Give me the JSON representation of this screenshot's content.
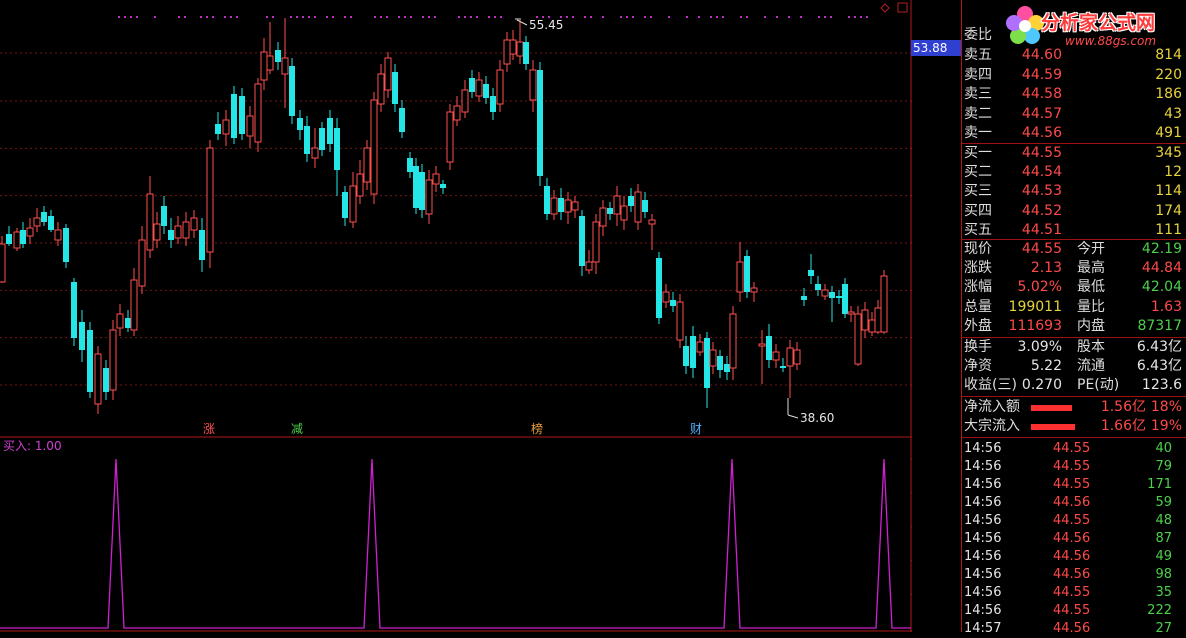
{
  "chart": {
    "high_label": "55.45",
    "low_label": "38.60",
    "current_axis_price": "53.88",
    "y_ticks": [
      "52.00",
      "50.00",
      "48.00",
      "46.00",
      "44.00",
      "42.00",
      "40.00"
    ],
    "events": [
      {
        "label": "涨",
        "color": "#ff5050",
        "x": 209
      },
      {
        "label": "减",
        "color": "#4cd04c",
        "x": 297
      },
      {
        "label": "榜",
        "color": "#e6a040",
        "x": 537
      },
      {
        "label": "财",
        "color": "#50b0ff",
        "x": 696
      }
    ],
    "indicator": {
      "title": "买入: 1.00",
      "y_ticks": [
        "1.00",
        "0.80",
        "0.60",
        "0.40",
        "0.20"
      ],
      "signal_positions": [
        116,
        372,
        732,
        884
      ]
    },
    "colors": {
      "up": "#ff5050",
      "down": "#24e6e6",
      "grid": "#7a1414",
      "signal": "#d020d0"
    }
  },
  "logo": {
    "brand": "分析家公式网",
    "url": "www.88gs.com"
  },
  "quote": {
    "weibi_label": "委比",
    "asks": [
      {
        "label": "卖五",
        "price": "44.60",
        "vol": "814"
      },
      {
        "label": "卖四",
        "price": "44.59",
        "vol": "220"
      },
      {
        "label": "卖三",
        "price": "44.58",
        "vol": "186"
      },
      {
        "label": "卖二",
        "price": "44.57",
        "vol": "43"
      },
      {
        "label": "卖一",
        "price": "44.56",
        "vol": "491"
      }
    ],
    "bids": [
      {
        "label": "买一",
        "price": "44.55",
        "vol": "345"
      },
      {
        "label": "买二",
        "price": "44.54",
        "vol": "12"
      },
      {
        "label": "买三",
        "price": "44.53",
        "vol": "114"
      },
      {
        "label": "买四",
        "price": "44.52",
        "vol": "174"
      },
      {
        "label": "买五",
        "price": "44.51",
        "vol": "111"
      }
    ],
    "stats": [
      {
        "l1": "现价",
        "v1": "44.55",
        "c1": "red",
        "l2": "今开",
        "v2": "42.19",
        "c2": "green"
      },
      {
        "l1": "涨跌",
        "v1": "2.13",
        "c1": "red",
        "l2": "最高",
        "v2": "44.84",
        "c2": "red"
      },
      {
        "l1": "涨幅",
        "v1": "5.02%",
        "c1": "red",
        "l2": "最低",
        "v2": "42.04",
        "c2": "green"
      },
      {
        "l1": "总量",
        "v1": "199011",
        "c1": "yellow",
        "l2": "量比",
        "v2": "1.63",
        "c2": "red"
      },
      {
        "l1": "外盘",
        "v1": "111693",
        "c1": "red",
        "l2": "内盘",
        "v2": "87317",
        "c2": "green"
      }
    ],
    "fin": [
      {
        "l1": "换手",
        "v1": "3.09%",
        "l2": "股本",
        "v2": "6.43亿"
      },
      {
        "l1": "净资",
        "v1": "5.22",
        "l2": "流通",
        "v2": "6.43亿"
      },
      {
        "l1": "收益(三)",
        "v1": "0.270",
        "l2": "PE(动)",
        "v2": "123.6"
      }
    ],
    "flows": [
      {
        "label": "净流入额",
        "amount": "1.56亿",
        "pct": "18%",
        "bar_fraction": 0.18
      },
      {
        "label": "大宗流入",
        "amount": "1.66亿",
        "pct": "19%",
        "bar_fraction": 0.19
      }
    ],
    "ticks": [
      {
        "time": "14:56",
        "price": "44.55",
        "vol": "40"
      },
      {
        "time": "14:56",
        "price": "44.55",
        "vol": "79"
      },
      {
        "time": "14:56",
        "price": "44.55",
        "vol": "171"
      },
      {
        "time": "14:56",
        "price": "44.56",
        "vol": "59"
      },
      {
        "time": "14:56",
        "price": "44.55",
        "vol": "48"
      },
      {
        "time": "14:56",
        "price": "44.56",
        "vol": "87"
      },
      {
        "time": "14:56",
        "price": "44.56",
        "vol": "49"
      },
      {
        "time": "14:56",
        "price": "44.56",
        "vol": "98"
      },
      {
        "time": "14:56",
        "price": "44.55",
        "vol": "35"
      },
      {
        "time": "14:56",
        "price": "44.55",
        "vol": "222"
      },
      {
        "time": "14:57",
        "price": "44.56",
        "vol": "27"
      }
    ]
  }
}
